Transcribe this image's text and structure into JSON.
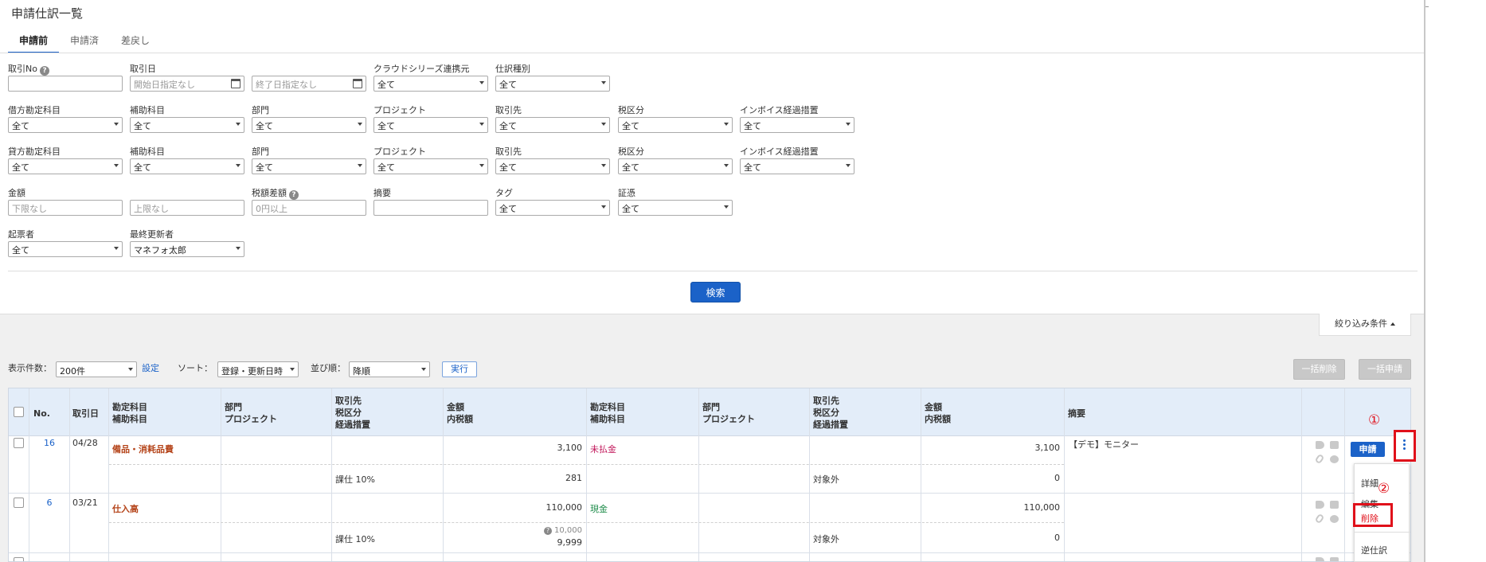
{
  "page": {
    "title": "申請仕訳一覧"
  },
  "tabs": [
    {
      "label": "申請前",
      "active": true
    },
    {
      "label": "申請済"
    },
    {
      "label": "差戻し"
    }
  ],
  "filters": {
    "torihiki_no": {
      "label": "取引No",
      "value": ""
    },
    "torihiki_date": {
      "label": "取引日",
      "start_placeholder": "開始日指定なし",
      "end_placeholder": "終了日指定なし"
    },
    "cloud_series": {
      "label": "クラウドシリーズ連携元",
      "value": "全て"
    },
    "shiwake_type": {
      "label": "仕訳種別",
      "value": "全て"
    },
    "debit": {
      "account": {
        "label": "借方勘定科目",
        "value": "全て"
      },
      "sub_account": {
        "label": "補助科目",
        "value": "全て"
      },
      "department": {
        "label": "部門",
        "value": "全て"
      },
      "project": {
        "label": "プロジェクト",
        "value": "全て"
      },
      "partner": {
        "label": "取引先",
        "value": "全て"
      },
      "tax": {
        "label": "税区分",
        "value": "全て"
      },
      "invoice": {
        "label": "インボイス経過措置",
        "value": "全て"
      }
    },
    "credit": {
      "account": {
        "label": "貸方勘定科目",
        "value": "全て"
      },
      "sub_account": {
        "label": "補助科目",
        "value": "全て"
      },
      "department": {
        "label": "部門",
        "value": "全て"
      },
      "project": {
        "label": "プロジェクト",
        "value": "全て"
      },
      "partner": {
        "label": "取引先",
        "value": "全て"
      },
      "tax": {
        "label": "税区分",
        "value": "全て"
      },
      "invoice": {
        "label": "インボイス経過措置",
        "value": "全て"
      }
    },
    "amount": {
      "label": "金額",
      "min_placeholder": "下限なし",
      "max_placeholder": "上限なし"
    },
    "tax_diff": {
      "label": "税額差額",
      "placeholder": "0円以上"
    },
    "memo": {
      "label": "摘要",
      "value": ""
    },
    "tag": {
      "label": "タグ",
      "value": "全て"
    },
    "evidence": {
      "label": "証憑",
      "value": "全て"
    },
    "creator": {
      "label": "起票者",
      "value": "全て"
    },
    "last_updater": {
      "label": "最終更新者",
      "value": "マネフォ太郎"
    },
    "search_button": "検索",
    "conditions_toggle": "絞り込み条件"
  },
  "list_controls": {
    "count_label": "表示件数：",
    "count_value": "200件",
    "settings_link": "設定",
    "sort_label": "ソート：",
    "sort_value": "登録・更新日時",
    "order_label": "並び順：",
    "order_value": "降順",
    "execute_button": "実行",
    "bulk_delete": "一括削除",
    "bulk_apply": "一括申請"
  },
  "table": {
    "headers": {
      "no": "No.",
      "date": "取引日",
      "debit_account": "勘定科目",
      "debit_sub": "補助科目",
      "debit_dept": "部門",
      "debit_proj": "プロジェクト",
      "debit_partner": "取引先",
      "debit_tax": "税区分",
      "debit_invoice": "経過措置",
      "debit_amount": "金額",
      "debit_tax_amount": "内税額",
      "credit_account": "勘定科目",
      "credit_sub": "補助科目",
      "credit_dept": "部門",
      "credit_proj": "プロジェクト",
      "credit_partner": "取引先",
      "credit_tax": "税区分",
      "credit_invoice": "経過措置",
      "credit_amount": "金額",
      "credit_tax_amount": "内税額",
      "memo": "摘要"
    },
    "rows": [
      {
        "no": "16",
        "date": "04/28",
        "debit_account": "備品・消耗品費",
        "debit_amount": "3,100",
        "debit_tax": "課仕 10%",
        "debit_tax_amount": "281",
        "credit_account": "未払金",
        "credit_amount": "3,100",
        "credit_tax": "対象外",
        "credit_tax_amount": "0",
        "memo": "【デモ】モニター",
        "apply_button": "申請"
      },
      {
        "no": "6",
        "date": "03/21",
        "debit_account": "仕入高",
        "debit_amount": "110,000",
        "debit_tax": "課仕 10%",
        "debit_tax_note": "10,000",
        "debit_tax_amount": "9,999",
        "credit_account": "現金",
        "credit_amount": "110,000",
        "credit_tax": "対象外",
        "credit_tax_amount": "0",
        "memo": ""
      }
    ]
  },
  "row_menu": {
    "items": [
      "詳細",
      "編集",
      "削除",
      "逆仕訳"
    ]
  },
  "annotations": {
    "step1": "①",
    "step2": "②"
  }
}
